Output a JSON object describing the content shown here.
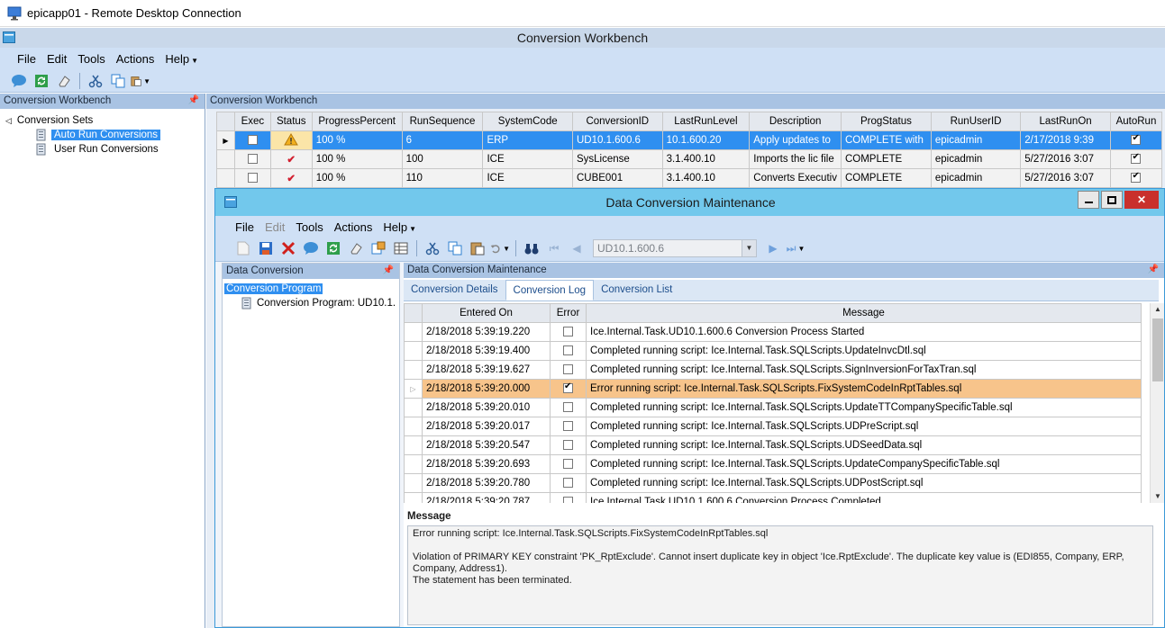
{
  "rdp": {
    "title": "epicapp01 - Remote Desktop Connection"
  },
  "app": {
    "title": "Conversion Workbench",
    "menu": [
      "File",
      "Edit",
      "Tools",
      "Actions",
      "Help"
    ]
  },
  "left_panel": {
    "header": "Conversion Workbench",
    "tree": {
      "root": "Conversion Sets",
      "items": [
        "Auto Run Conversions",
        "User Run Conversions"
      ]
    }
  },
  "right_panel": {
    "header": "Conversion Workbench",
    "grid": {
      "columns": [
        "Exec",
        "Status",
        "ProgressPercent",
        "RunSequence",
        "SystemCode",
        "ConversionID",
        "LastRunLevel",
        "Description",
        "ProgStatus",
        "RunUserID",
        "LastRunOn",
        "AutoRun"
      ],
      "rows": [
        {
          "exec": false,
          "status": "warning-icon",
          "progress": "100 %",
          "seq": "6",
          "system": "ERP",
          "id": "UD10.1.600.6",
          "level": "10.1.600.20",
          "desc": "Apply updates to",
          "prog": "COMPLETE with",
          "user": "epicadmin",
          "last": "2/17/2018 9:39",
          "auto": true
        },
        {
          "exec": false,
          "status": "check-icon",
          "progress": "100 %",
          "seq": "100",
          "system": "ICE",
          "id": "SysLicense",
          "level": "3.1.400.10",
          "desc": "Imports the lic file",
          "prog": "COMPLETE",
          "user": "epicadmin",
          "last": "5/27/2016 3:07",
          "auto": true
        },
        {
          "exec": false,
          "status": "check-icon",
          "progress": "100 %",
          "seq": "110",
          "system": "ICE",
          "id": "CUBE001",
          "level": "3.1.400.10",
          "desc": "Converts Executiv",
          "prog": "COMPLETE",
          "user": "epicadmin",
          "last": "5/27/2016 3:07",
          "auto": true
        }
      ]
    }
  },
  "dialog": {
    "title": "Data Conversion Maintenance",
    "menu": [
      "File",
      "Edit",
      "Tools",
      "Actions",
      "Help"
    ],
    "combo_value": "UD10.1.600.6",
    "left_header": "Data Conversion",
    "tree": {
      "root": "Conversion Program",
      "child": "Conversion Program: UD10.1."
    },
    "right_header": "Data Conversion Maintenance",
    "tabs": [
      "Conversion Details",
      "Conversion Log",
      "Conversion List"
    ],
    "log": {
      "columns": [
        "Entered On",
        "Error",
        "Message"
      ],
      "rows": [
        {
          "on": "2/18/2018 5:39:19.220",
          "error": false,
          "msg": "Ice.Internal.Task.UD10.1.600.6 Conversion Process Started"
        },
        {
          "on": "2/18/2018 5:39:19.400",
          "error": false,
          "msg": "Completed running script: Ice.Internal.Task.SQLScripts.UpdateInvcDtl.sql"
        },
        {
          "on": "2/18/2018 5:39:19.627",
          "error": false,
          "msg": "Completed running script: Ice.Internal.Task.SQLScripts.SignInversionForTaxTran.sql"
        },
        {
          "on": "2/18/2018 5:39:20.000",
          "error": true,
          "msg": "Error running script: Ice.Internal.Task.SQLScripts.FixSystemCodeInRptTables.sql"
        },
        {
          "on": "2/18/2018 5:39:20.010",
          "error": false,
          "msg": "Completed running script: Ice.Internal.Task.SQLScripts.UpdateTTCompanySpecificTable.sql"
        },
        {
          "on": "2/18/2018 5:39:20.017",
          "error": false,
          "msg": "Completed running script: Ice.Internal.Task.SQLScripts.UDPreScript.sql"
        },
        {
          "on": "2/18/2018 5:39:20.547",
          "error": false,
          "msg": "Completed running script: Ice.Internal.Task.SQLScripts.UDSeedData.sql"
        },
        {
          "on": "2/18/2018 5:39:20.693",
          "error": false,
          "msg": "Completed running script: Ice.Internal.Task.SQLScripts.UpdateCompanySpecificTable.sql"
        },
        {
          "on": "2/18/2018 5:39:20.780",
          "error": false,
          "msg": "Completed running script: Ice.Internal.Task.SQLScripts.UDPostScript.sql"
        },
        {
          "on": "2/18/2018 5:39:20.787",
          "error": false,
          "msg": "Ice.Internal.Task.UD10.1.600.6 Conversion Process Completed"
        }
      ]
    },
    "message_label": "Message",
    "message_lines": [
      "Error running script: Ice.Internal.Task.SQLScripts.FixSystemCodeInRptTables.sql",
      "Violation of PRIMARY KEY constraint 'PK_RptExclude'. Cannot insert duplicate key in object 'Ice.RptExclude'. The duplicate key value is (EDI855, Company, ERP, Company, Address1).\nThe statement has been terminated."
    ]
  }
}
